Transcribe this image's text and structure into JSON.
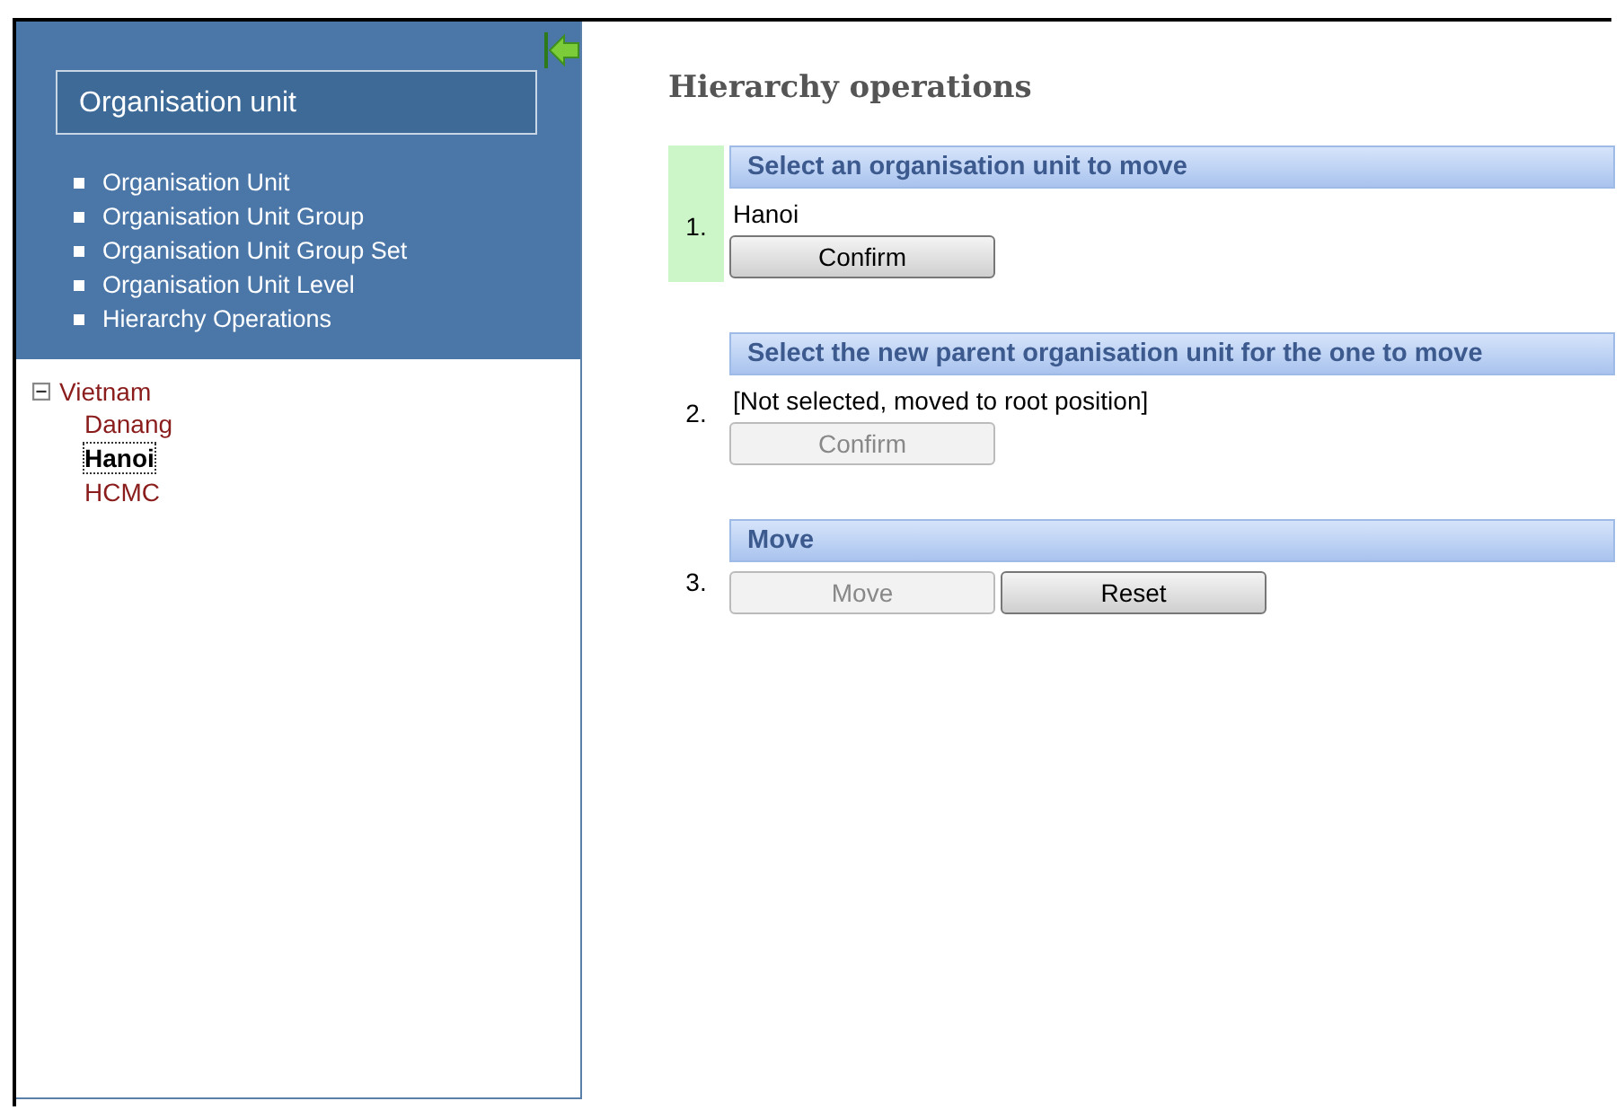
{
  "sidebar": {
    "title": "Organisation unit",
    "menu": [
      {
        "label": "Organisation Unit"
      },
      {
        "label": "Organisation Unit Group"
      },
      {
        "label": "Organisation Unit Group Set"
      },
      {
        "label": "Organisation Unit Level"
      },
      {
        "label": "Hierarchy Operations"
      }
    ],
    "tree": [
      {
        "label": "Vietnam",
        "expanded": true,
        "selected": false,
        "children": [
          {
            "label": "Danang",
            "selected": false
          },
          {
            "label": "Hanoi",
            "selected": true
          },
          {
            "label": "HCMC",
            "selected": false
          }
        ]
      }
    ]
  },
  "page_title": "Hierarchy operations",
  "steps": [
    {
      "number": "1.",
      "heading": "Select an organisation unit to move",
      "active": true,
      "value": "Hanoi",
      "buttons": [
        {
          "label": "Confirm",
          "disabled": false
        }
      ]
    },
    {
      "number": "2.",
      "heading": "Select the new parent organisation unit for the one to move",
      "active": false,
      "value": "[Not selected, moved to root position]",
      "buttons": [
        {
          "label": "Confirm",
          "disabled": true
        }
      ]
    },
    {
      "number": "3.",
      "heading": "Move",
      "active": false,
      "buttons": [
        {
          "label": "Move",
          "disabled": true
        },
        {
          "label": "Reset",
          "disabled": false
        }
      ]
    }
  ]
}
